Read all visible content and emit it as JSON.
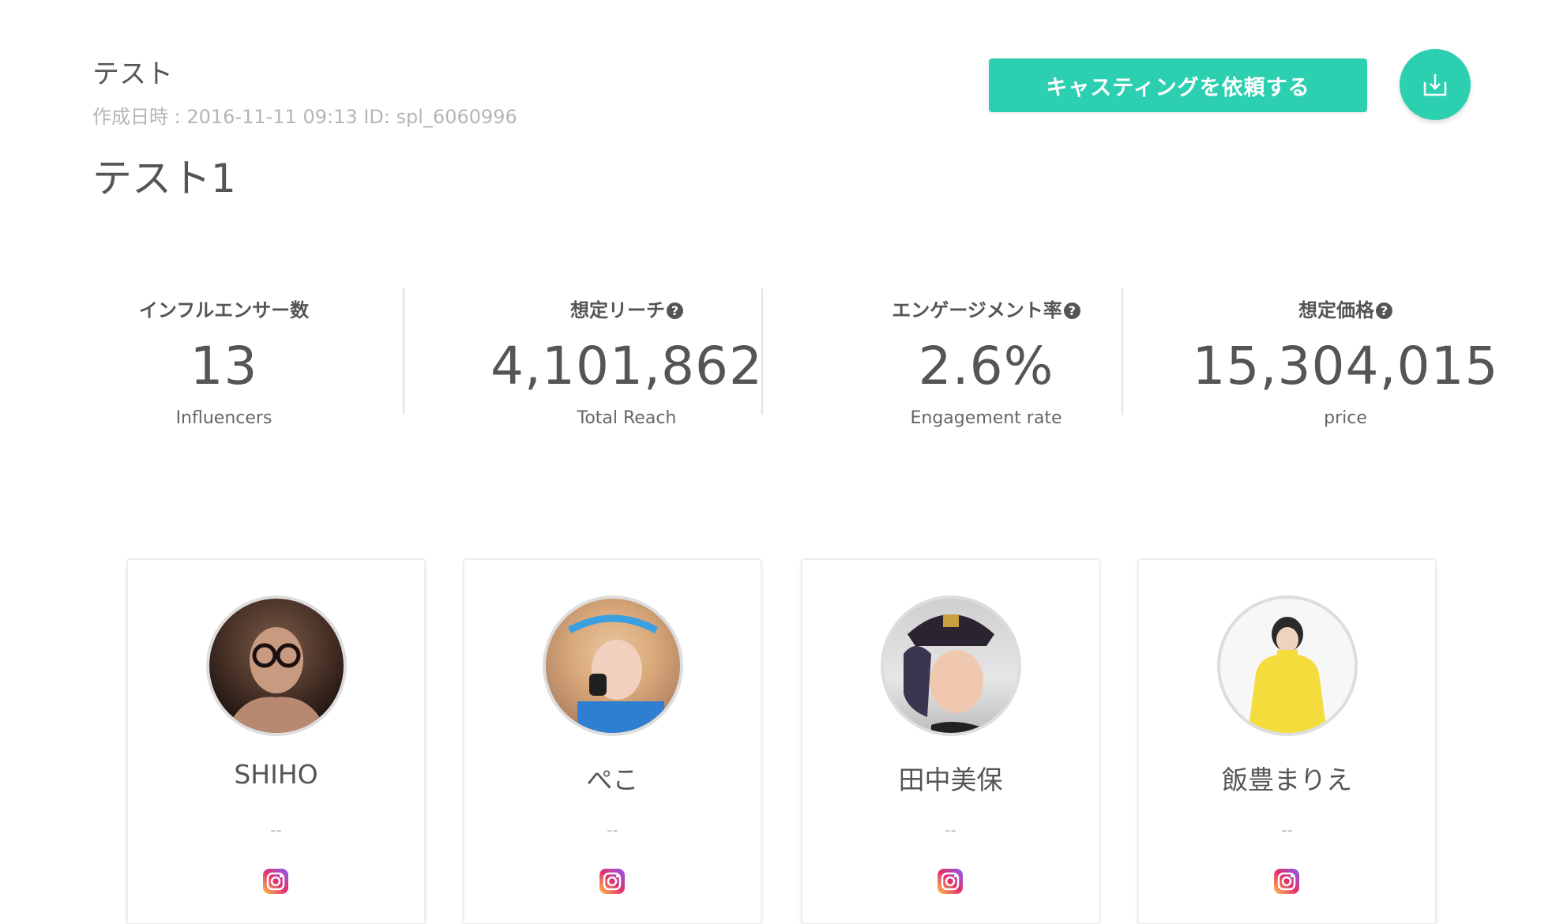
{
  "header": {
    "project_label": "テスト",
    "meta": "作成日時 : 2016-11-11 09:13 ID: spl_6060996",
    "title": "テスト1",
    "cast_button": "キャスティングを依頼する"
  },
  "stats": [
    {
      "label": "インフルエンサー数",
      "value": "13",
      "sub": "Influencers",
      "help": false
    },
    {
      "label": "想定リーチ",
      "value": "4,101,862",
      "sub": "Total Reach",
      "help": true
    },
    {
      "label": "エンゲージメント率",
      "value": "2.6%",
      "sub": "Engagement rate",
      "help": true
    },
    {
      "label": "想定価格",
      "value": "15,304,015",
      "sub": "price",
      "help": true
    }
  ],
  "help_glyph": "?",
  "influencers": [
    {
      "name": "SHIHO",
      "detail": "--",
      "platform": "instagram-icon"
    },
    {
      "name": "ぺこ",
      "detail": "--",
      "platform": "instagram-icon"
    },
    {
      "name": "田中美保",
      "detail": "--",
      "platform": "instagram-icon"
    },
    {
      "name": "飯豊まりえ",
      "detail": "--",
      "platform": "instagram-icon"
    }
  ],
  "colors": {
    "accent": "#2cd0b0",
    "text": "#555555",
    "muted": "#b5b5b5"
  }
}
